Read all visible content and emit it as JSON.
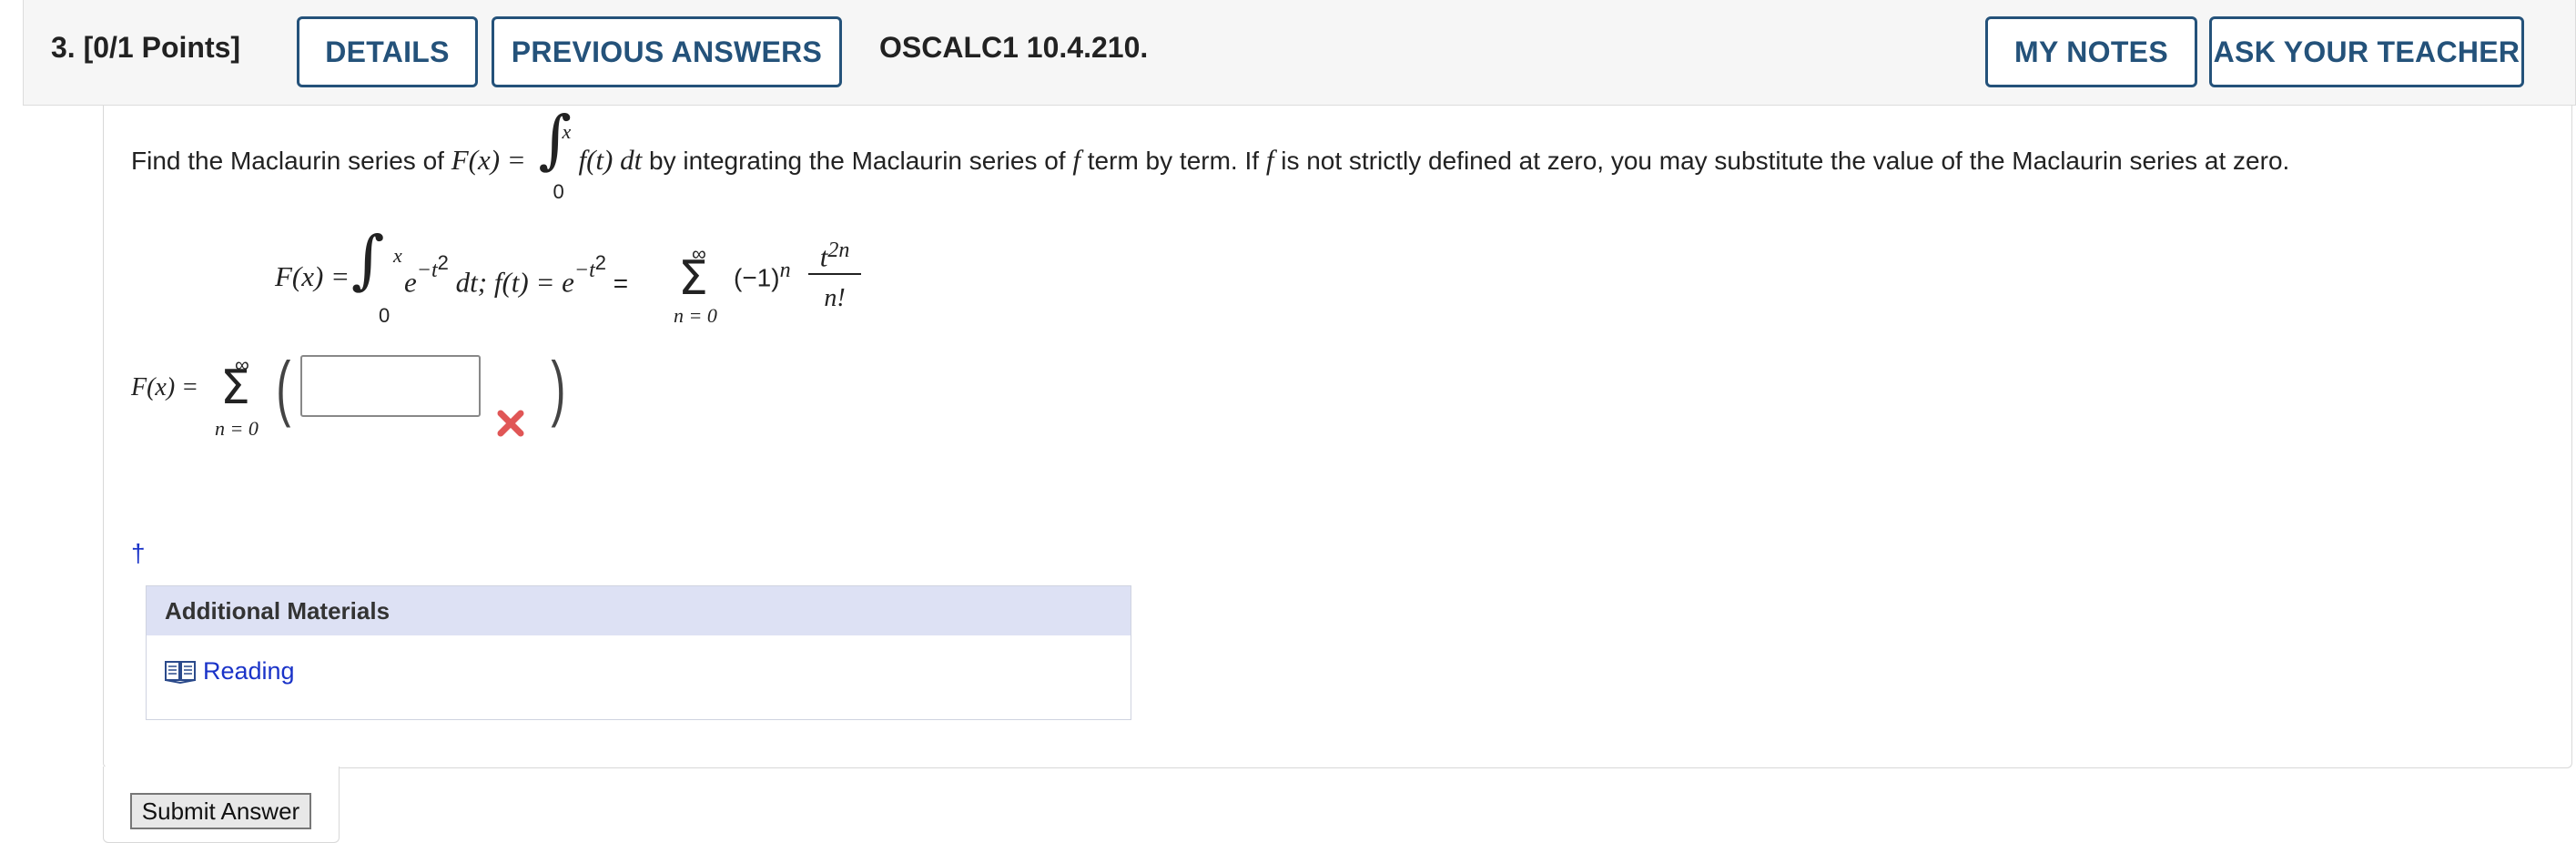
{
  "header": {
    "question_number": "3.",
    "points": "[0/1 Points]",
    "details_label": "DETAILS",
    "previous_answers_label": "PREVIOUS ANSWERS",
    "problem_id": "OSCALC1 10.4.210.",
    "my_notes_label": "MY NOTES",
    "ask_teacher_label": "ASK YOUR TEACHER"
  },
  "question": {
    "prompt_start": "Find the Maclaurin series of ",
    "prompt_F": "F(x) = ",
    "prompt_integrand": "f(t) dt",
    "prompt_rest": " by integrating the Maclaurin series of ",
    "prompt_f1": "f",
    "prompt_mid": " term by term. If ",
    "prompt_f2": "f",
    "prompt_end": " is not strictly defined at zero, you may substitute the value of the Maclaurin series at zero.",
    "integral_upper": "x",
    "integral_lower": "0",
    "given_lhs": "F(x) = ",
    "given_integrand_base": "e",
    "given_integrand_exp": "−t",
    "given_exp_power": "2",
    "given_dt": " dt; ",
    "given_f": "f(t) = e",
    "given_equals": " = ",
    "sum_upper": "∞",
    "sum_lower": "n = 0",
    "given_term": "(−1)",
    "given_term_exp": "n",
    "frac_num": "t",
    "frac_num_exp": "2n",
    "frac_den": "n!",
    "answer_lhs": "F(x) = ",
    "answer_value": "",
    "answer_status": "incorrect",
    "dagger": "†"
  },
  "additional_materials": {
    "title": "Additional Materials",
    "reading_label": "Reading"
  },
  "submit_label": "Submit Answer",
  "colors": {
    "accent": "#24527a",
    "link": "#1a33c8",
    "incorrect": "#e05656",
    "materials_header_bg": "#dde1f4"
  }
}
